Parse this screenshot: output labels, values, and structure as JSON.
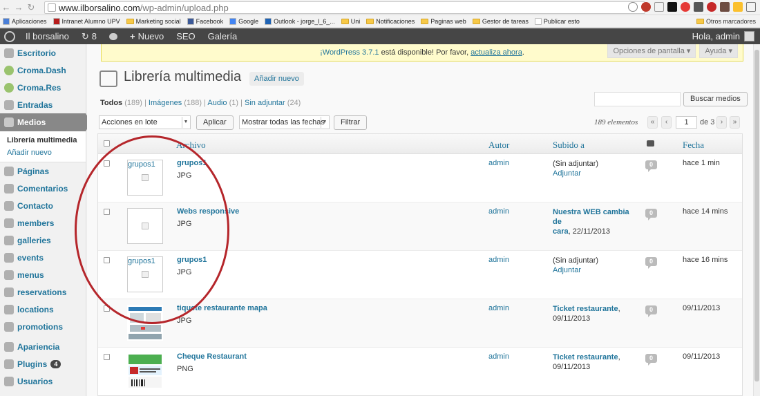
{
  "browser": {
    "url_host": "www.ilborsalino.com",
    "url_path": "/wp-admin/upload.php",
    "bookmarks": [
      {
        "label": "Aplicaciones",
        "color": "#4a7fd8"
      },
      {
        "label": "Intranet Alumno UPV",
        "color": "#b71c1c"
      },
      {
        "label": "Marketing social",
        "color": "folder"
      },
      {
        "label": "Facebook",
        "color": "#3b5998"
      },
      {
        "label": "Google",
        "color": "#4285f4"
      },
      {
        "label": "Outlook - jorge_l_6_...",
        "color": "#1e63b5"
      },
      {
        "label": "Uni",
        "color": "folder"
      },
      {
        "label": "Notificaciones",
        "color": "folder"
      },
      {
        "label": "Paginas web",
        "color": "folder"
      },
      {
        "label": "Gestor de tareas",
        "color": "folder"
      },
      {
        "label": "Publicar esto",
        "color": "#ffffff"
      }
    ],
    "other_bookmarks": "Otros marcadores"
  },
  "adminbar": {
    "site": "Il borsalino",
    "updates": "8",
    "new": "Nuevo",
    "seo": "SEO",
    "gallery": "Galería",
    "greeting": "Hola, admin"
  },
  "sidebar": {
    "items": [
      {
        "label": "Escritorio"
      },
      {
        "label": "Croma.Dash"
      },
      {
        "label": "Croma.Res"
      },
      {
        "label": "Entradas"
      },
      {
        "label": "Medios"
      },
      {
        "label": "Páginas"
      },
      {
        "label": "Comentarios"
      },
      {
        "label": "Contacto"
      },
      {
        "label": "members"
      },
      {
        "label": "galleries"
      },
      {
        "label": "events"
      },
      {
        "label": "menus"
      },
      {
        "label": "reservations"
      },
      {
        "label": "locations"
      },
      {
        "label": "promotions"
      },
      {
        "label": "Apariencia"
      },
      {
        "label": "Plugins",
        "badge": "4"
      },
      {
        "label": "Usuarios"
      }
    ],
    "submenu": [
      "Librería multimedia",
      "Añadir nuevo"
    ]
  },
  "notice": {
    "link1": "¡WordPress 3.7.1",
    "text": " está disponible! Por favor, ",
    "link2": "actualiza ahora",
    "end": "."
  },
  "screen_options": "Opciones de pantalla",
  "help": "Ayuda",
  "page": {
    "title": "Librería multimedia",
    "add_new": "Añadir nuevo",
    "search_button": "Buscar medios"
  },
  "filters": {
    "all": "Todos",
    "all_count": "(189)",
    "images": "Imágenes",
    "images_count": "(188)",
    "audio": "Audio",
    "audio_count": "(1)",
    "unattached": "Sin adjuntar",
    "unattached_count": "(24)"
  },
  "bulk": {
    "select": "Acciones en lote",
    "apply": "Aplicar",
    "dates": "Mostrar todas las fechas",
    "filter": "Filtrar"
  },
  "pagination": {
    "count": "189 elementos",
    "current": "1",
    "of": "de 3"
  },
  "table": {
    "columns": {
      "file": "Archivo",
      "author": "Autor",
      "uploaded": "Subido a",
      "date": "Fecha"
    },
    "rows": [
      {
        "title": "grupos1",
        "type": "JPG",
        "author": "admin",
        "att_line1": "(Sin adjuntar)",
        "att_line2": "Adjuntar",
        "comments": "0",
        "date": "hace 1 min",
        "thumb_alt": "grupos1"
      },
      {
        "title": "Webs responsive",
        "type": "JPG",
        "author": "admin",
        "att_line1": "Nuestra WEB cambia de",
        "att_line2": "cara",
        "att_suffix": ", 22/11/2013",
        "comments": "0",
        "date": "hace 14 mins",
        "thumb_alt": ""
      },
      {
        "title": "grupos1",
        "type": "JPG",
        "author": "admin",
        "att_line1": "(Sin adjuntar)",
        "att_line2": "Adjuntar",
        "comments": "0",
        "date": "hace 16 mins",
        "thumb_alt": "grupos1"
      },
      {
        "title": "tiquete restaurante mapa",
        "type": "JPG",
        "author": "admin",
        "att_line1": "Ticket restaurante",
        "att_line1_suffix": ",",
        "att_line2": "09/11/2013",
        "comments": "0",
        "date": "09/11/2013",
        "thumb_alt": ""
      },
      {
        "title": "Cheque Restaurant",
        "type": "PNG",
        "author": "admin",
        "att_line1": "Ticket restaurante",
        "att_line1_suffix": ",",
        "att_line2": "09/11/2013",
        "comments": "0",
        "date": "09/11/2013",
        "thumb_alt": ""
      }
    ]
  },
  "colors": {
    "link": "#21759b",
    "adminbar": "#464646",
    "annotation": "#b5262b"
  }
}
